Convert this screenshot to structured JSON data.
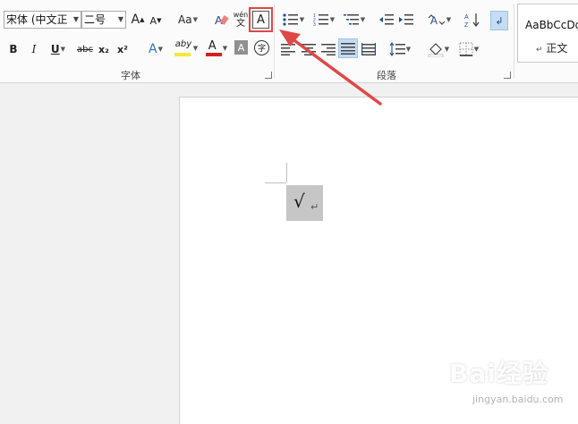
{
  "font_group": {
    "label": "字体",
    "font_name": "宋体 (中文正",
    "font_size": "二号"
  },
  "paragraph_group": {
    "label": "段落"
  },
  "styles_group": {
    "sample_text": "AaBbCcDd",
    "style_name": "正文"
  },
  "buttons": {
    "grow": "A",
    "shrink": "A",
    "change_case": "Aa",
    "bold": "B",
    "italic": "I",
    "underline": "U",
    "strike": "abc",
    "subscript": "x₂",
    "superscript": "x²",
    "text_effects": "A",
    "highlight": "aby",
    "font_color": "A",
    "char_shading": "A",
    "enclose_char": "字",
    "char_border": "A",
    "phonetic_top": "wén",
    "phonetic_bottom": "文"
  },
  "document": {
    "mark": "√",
    "paragraph_mark": "↵"
  },
  "watermark": {
    "brand": "Bai经验",
    "url": "jingyan.baidu.com"
  },
  "colors": {
    "annotation_red": "#e04848",
    "highlight_yellow": "#f5e83a",
    "font_red": "#d81e1e",
    "ribbon_bg": "#fbfbfb"
  }
}
